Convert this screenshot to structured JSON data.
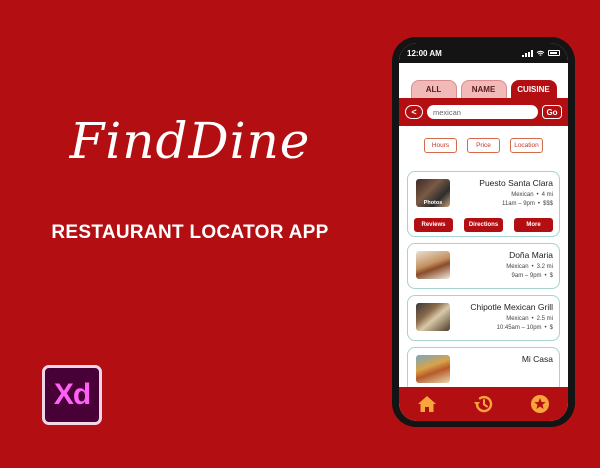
{
  "branding": {
    "title": "FindDine",
    "subtitle": "RESTAURANT LOCATOR APP",
    "tool_logo_text": "Xd"
  },
  "phone": {
    "status_time": "12:00 AM",
    "tabs": [
      {
        "label": "ALL",
        "active": false
      },
      {
        "label": "NAME",
        "active": false
      },
      {
        "label": "CUISINE",
        "active": true
      }
    ],
    "search": {
      "back_label": "<",
      "value": "mexican",
      "go_label": "Go"
    },
    "filters": [
      "Hours",
      "Price",
      "Location"
    ],
    "restaurants": [
      {
        "name": "Puesto Santa Clara",
        "cuisine": "Mexican",
        "distance": "4 mi",
        "hours": "11am – 9pm",
        "price": "$$$",
        "thumb_label": "Photos",
        "expanded": true,
        "buttons": [
          "Reviews",
          "Directions",
          "More"
        ]
      },
      {
        "name": "Doña Maria",
        "cuisine": "Mexican",
        "distance": "3.2 mi",
        "hours": "9am – 9pm",
        "price": "$"
      },
      {
        "name": "Chipotle Mexican Grill",
        "cuisine": "Mexican",
        "distance": "2.5 mi",
        "hours": "10:45am – 10pm",
        "price": "$"
      },
      {
        "name": "Mi Casa"
      }
    ],
    "bottom_nav": [
      "home-icon",
      "history-icon",
      "favorites-star-icon"
    ],
    "colors": {
      "primary": "#b30f12",
      "card_border": "#a7d3cf",
      "tab_inactive": "#f2b9b9"
    }
  }
}
